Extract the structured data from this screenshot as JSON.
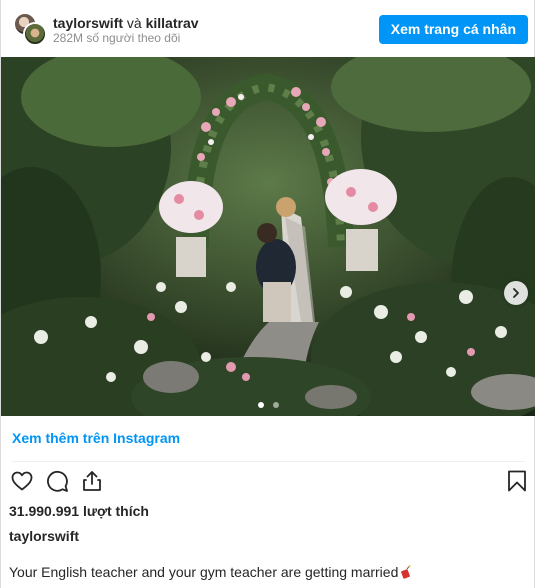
{
  "header": {
    "user1": "taylorswift",
    "conjunction": "và",
    "user2": "killatrav",
    "followers": "282M số người theo dõi",
    "profile_button": "Xem trang cá nhân"
  },
  "carousel": {
    "slide_count": 2,
    "active_index": 0
  },
  "post": {
    "view_more_link": "Xem thêm trên Instagram",
    "likes": "31.990.991 lượt thích",
    "owner": "taylorswift",
    "caption": "Your English teacher and your gym teacher are getting married",
    "caption_emoji": "firecracker-icon"
  },
  "colors": {
    "accent": "#0095f6",
    "text": "#262626",
    "muted": "#8e8e8e"
  }
}
